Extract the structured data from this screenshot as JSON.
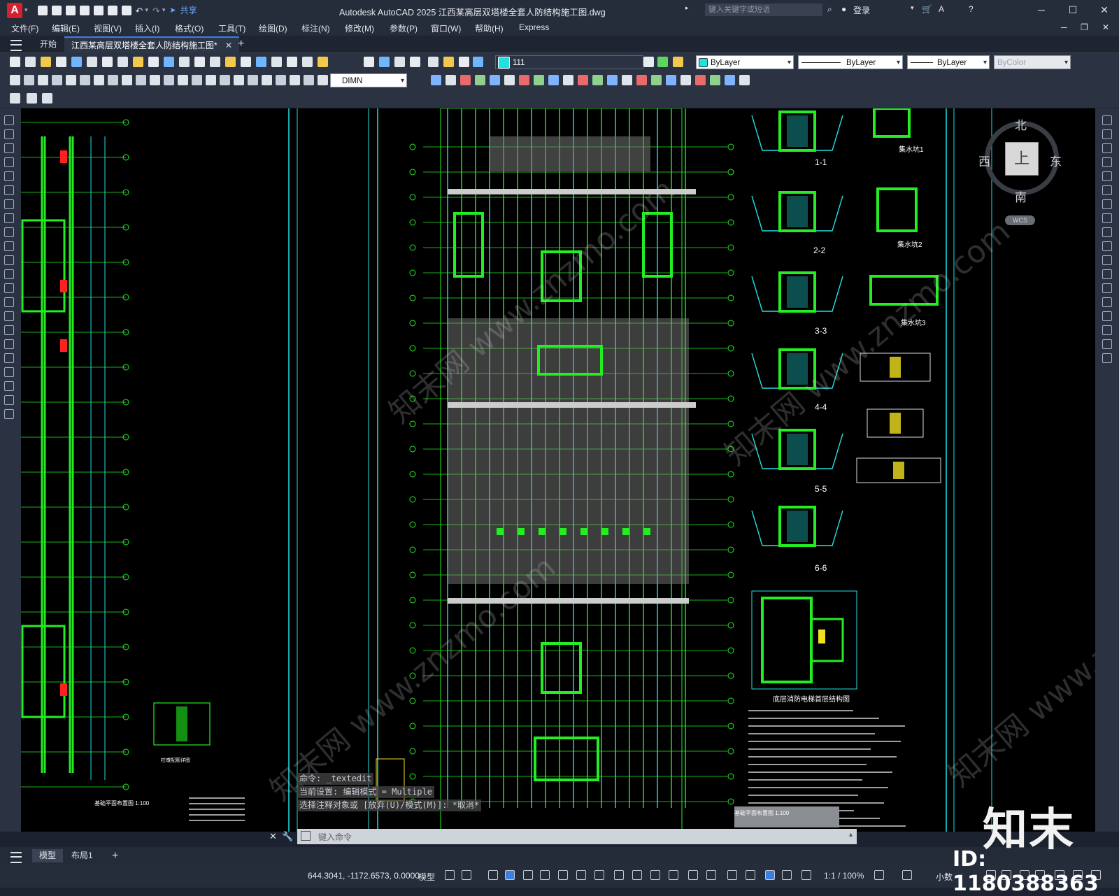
{
  "app": {
    "logo_letter": "A",
    "share_label": "共享",
    "title": "Autodesk AutoCAD 2025    江西某高层双塔楼全套人防结构施工图.dwg",
    "search_placeholder": "键入关键字或短语",
    "login_label": "登录"
  },
  "menu": [
    "文件(F)",
    "编辑(E)",
    "视图(V)",
    "插入(I)",
    "格式(O)",
    "工具(T)",
    "绘图(D)",
    "标注(N)",
    "修改(M)",
    "参数(P)",
    "窗口(W)",
    "帮助(H)",
    "Express"
  ],
  "tabs": {
    "start": "开始",
    "drawing": "江西某高层双塔楼全套人防结构施工图*",
    "add": "+"
  },
  "layer_toolbar": {
    "current_layer": "111",
    "color": "ByLayer",
    "linetype": "ByLayer",
    "lineweight": "ByLayer",
    "plot_style": "ByColor"
  },
  "dim_toolbar": {
    "dim_style": "DIMN"
  },
  "viewcube": {
    "north": "北",
    "south": "南",
    "east": "东",
    "west": "西",
    "face": "上",
    "wcs": "WCS"
  },
  "drawing": {
    "sections": [
      "1-1",
      "2-2",
      "3-3",
      "4-4",
      "5-5",
      "6-6"
    ],
    "sump_labels": [
      "集水坑1",
      "集水坑2",
      "集水坑3"
    ],
    "elevator_title": "底层消防电梯首层结构图",
    "left_plan_title": "基础平面布置图 1:100",
    "right_plan_title": "基础平面布置图 1:100",
    "detail_title": "柱墩配筋详图"
  },
  "command": {
    "history": [
      "命令: _textedit",
      "当前设置: 编辑模式 = Multiple",
      "选择注释对象或 [放弃(U)/模式(M)]: *取消*"
    ],
    "input_placeholder": "键入命令"
  },
  "layout_tabs": [
    "模型",
    "布局1"
  ],
  "status": {
    "coordinates": "644.3041, -1172.6573, 0.0000",
    "mode": "模型",
    "scale": "1:1 / 100%",
    "units": "小数"
  },
  "branding": {
    "logo": "知末",
    "id": "ID: 1180388363",
    "watermark": "知末网 www.znzmo.com"
  },
  "colors": {
    "accent": "#3c7fe0",
    "cad_green": "#22ee22",
    "cad_cyan": "#22e0e0",
    "cad_yellow": "#f0e020",
    "cad_red": "#ff2020"
  }
}
